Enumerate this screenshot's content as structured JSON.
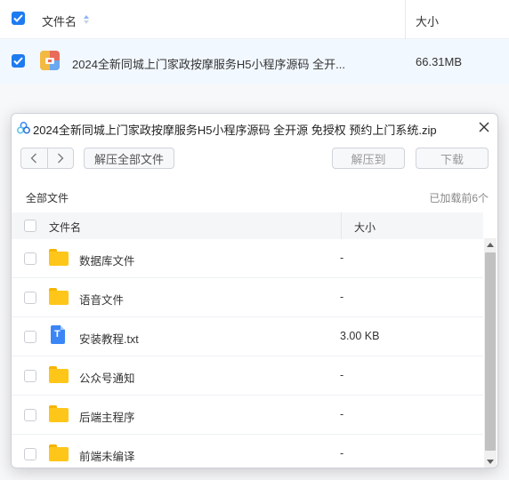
{
  "background": {
    "header": {
      "name_col": "文件名",
      "size_col": "大小"
    },
    "row": {
      "file_name": "2024全新同城上门家政按摩服务H5小程序源码 全开...",
      "file_size": "66.31MB"
    }
  },
  "dialog": {
    "title": "2024全新同城上门家政按摩服务H5小程序源码 全开源 免授权 预约上门系统.zip",
    "toolbar": {
      "extract_all": "解压全部文件",
      "extract_to": "解压到",
      "download": "下载"
    },
    "breadcrumb": "全部文件",
    "loaded_status": "已加载前6个",
    "columns": {
      "name": "文件名",
      "size": "大小"
    },
    "files": [
      {
        "name": "数据库文件",
        "size": "-",
        "icon": "folder-icon"
      },
      {
        "name": "语音文件",
        "size": "-",
        "icon": "folder-icon"
      },
      {
        "name": "安装教程.txt",
        "size": "3.00 KB",
        "icon": "text-file-icon"
      },
      {
        "name": "公众号通知",
        "size": "-",
        "icon": "folder-icon"
      },
      {
        "name": "后端主程序",
        "size": "-",
        "icon": "folder-icon"
      },
      {
        "name": "前端未编译",
        "size": "-",
        "icon": "folder-icon"
      }
    ]
  },
  "colors": {
    "accent": "#1e7bf0",
    "folder": "#ffc61a",
    "row_selected": "#f2f8ff"
  }
}
